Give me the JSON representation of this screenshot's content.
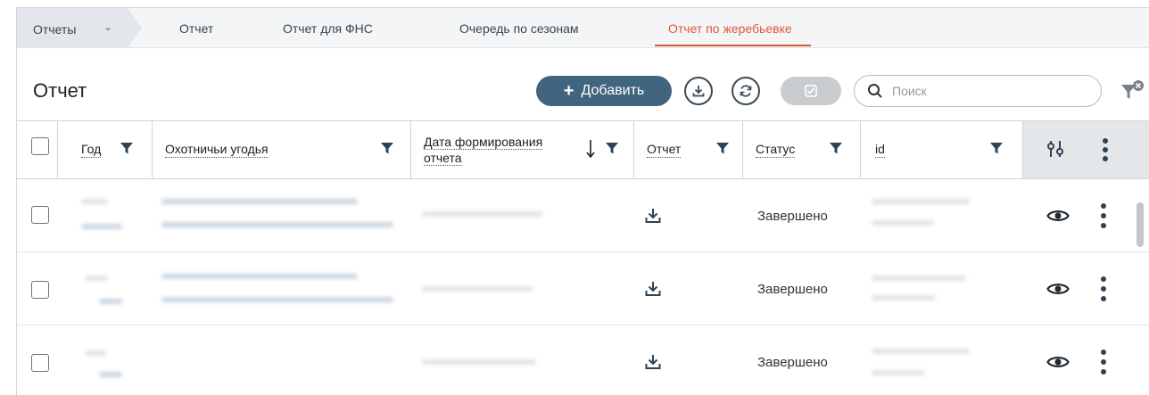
{
  "tabs": {
    "breadcrumb": "Отчеты",
    "items": [
      "Отчет",
      "Отчет для ФНС",
      "Очередь по сезонам",
      "Отчет по жеребьевке"
    ],
    "active_index": 3
  },
  "toolbar": {
    "title": "Отчет",
    "add_label": "Добавить",
    "search_placeholder": "Поиск"
  },
  "table": {
    "columns": [
      "Год",
      "Охотничьи угодья",
      "Дата формирования",
      "отчета",
      "Отчет",
      "Статус",
      "id"
    ],
    "sort_column": "Дата формирования отчета",
    "sort_direction": "desc",
    "rows": [
      {
        "status": "Завершено"
      },
      {
        "status": "Завершено"
      },
      {
        "status": "Завершено"
      }
    ]
  },
  "colors": {
    "accent": "#e0583a",
    "primary_button": "#41647f",
    "header_tools_bg": "#e4e7ea"
  }
}
